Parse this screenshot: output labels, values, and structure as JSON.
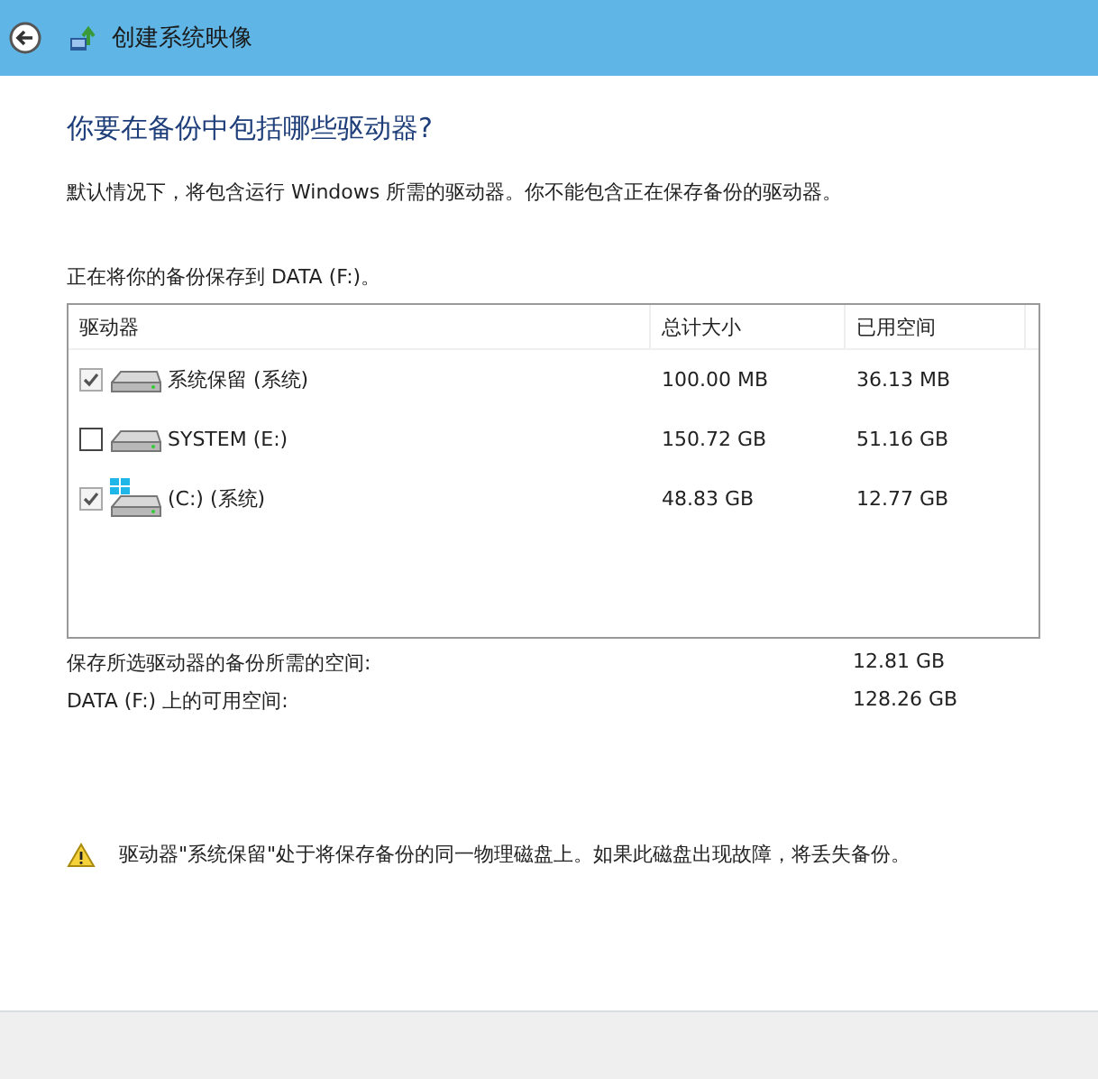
{
  "window": {
    "title": "创建系统映像"
  },
  "heading": "你要在备份中包括哪些驱动器?",
  "description": "默认情况下，将包含运行 Windows 所需的驱动器。你不能包含正在保存备份的驱动器。",
  "destination": "正在将你的备份保存到 DATA (F:)。",
  "table": {
    "columns": [
      "驱动器",
      "总计大小",
      "已用空间"
    ],
    "rows": [
      {
        "name": "系统保留 (系统)",
        "kind": "disk",
        "checked": true,
        "disabled": true,
        "total": "100.00 MB",
        "used": "36.13 MB"
      },
      {
        "name": "SYSTEM (E:)",
        "kind": "disk",
        "checked": false,
        "disabled": false,
        "total": "150.72 GB",
        "used": "51.16 GB"
      },
      {
        "name": "(C:) (系统)",
        "kind": "windows-disk",
        "checked": true,
        "disabled": true,
        "total": "48.83 GB",
        "used": "12.77 GB"
      }
    ]
  },
  "summary": [
    {
      "label": "保存所选驱动器的备份所需的空间:",
      "value": "12.81 GB"
    },
    {
      "label": "DATA (F:) 上的可用空间:",
      "value": "128.26 GB"
    }
  ],
  "warning": "驱动器\"系统保留\"处于将保存备份的同一物理磁盘上。如果此磁盘出现故障，将丢失备份。"
}
